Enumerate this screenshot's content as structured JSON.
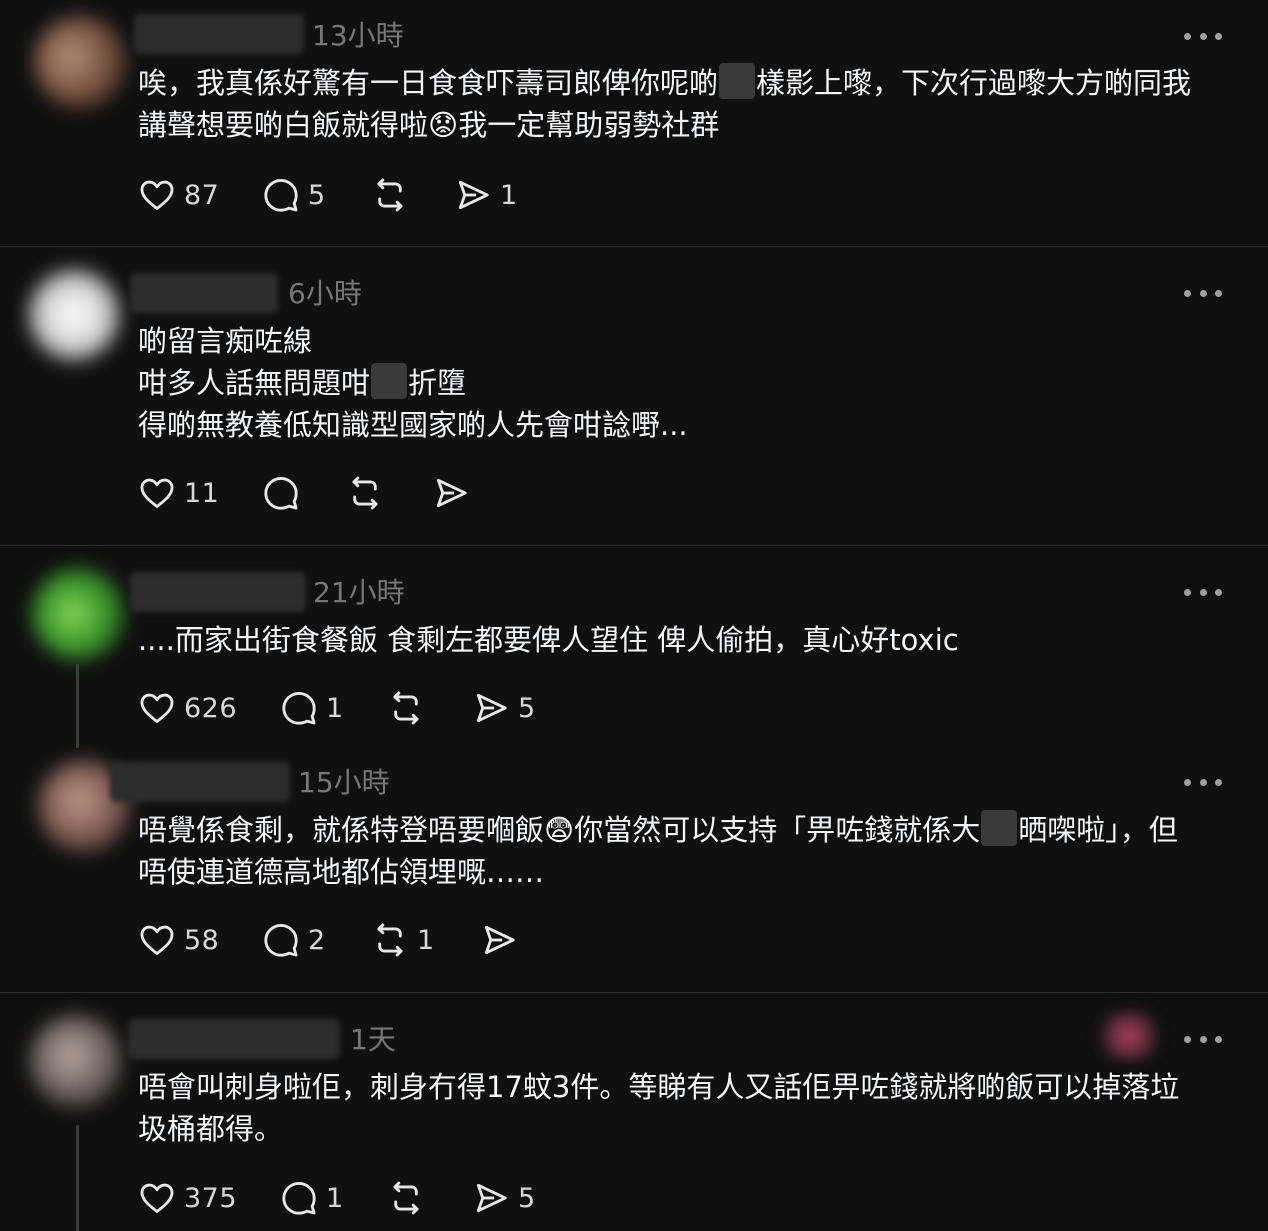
{
  "posts": [
    {
      "time": "13小時",
      "lines": [
        {
          "a": "唉，我真係好驚有一日食食吓壽司郎俾你呢啲",
          "b": "樣影上嚟，下次行過嚟大方啲同我"
        },
        {
          "a": "講聲想要啲白飯就得啦😟我一定幫助弱勢社群"
        }
      ],
      "likes": "87",
      "replies": "5",
      "reposts": "",
      "shares": "1"
    },
    {
      "time": "6小時",
      "lines": [
        {
          "a": "啲留言痴咗線"
        },
        {
          "a": "咁多人話無問題咁",
          "b": "折墮"
        },
        {
          "a": "得啲無教養低知識型國家啲人先會咁諗嘢..."
        }
      ],
      "likes": "11",
      "replies": "",
      "reposts": "",
      "shares": ""
    },
    {
      "time": "21小時",
      "lines": [
        {
          "a": "....而家出街食餐飯 食剩左都要俾人望住 俾人偷拍，真心好toxic"
        }
      ],
      "likes": "626",
      "replies": "1",
      "reposts": "",
      "shares": "5"
    },
    {
      "time": "15小時",
      "lines": [
        {
          "a": "唔覺係食剩，就係特登唔要嗰飯😨你當然可以支持「畀咗錢就係大",
          "b": "晒㗎啦」，但"
        },
        {
          "a": "唔使連道德高地都佔領埋嘅……"
        }
      ],
      "likes": "58",
      "replies": "2",
      "reposts": "1",
      "shares": ""
    },
    {
      "time": "1天",
      "lines": [
        {
          "a": "唔會叫刺身啦佢，刺身冇得17蚊3件。等睇有人又話佢畀咗錢就將啲飯可以掉落垃"
        },
        {
          "a": "圾桶都得。"
        }
      ],
      "likes": "375",
      "replies": "1",
      "reposts": "",
      "shares": "5"
    }
  ],
  "icons": {
    "like": "heart-icon",
    "reply": "comment-bubble-icon",
    "repost": "repost-icon",
    "share": "send-icon",
    "more": "more-horizontal-icon"
  },
  "colors": {
    "background": "#101010",
    "text": "#f3f5f7",
    "muted": "#777777"
  }
}
